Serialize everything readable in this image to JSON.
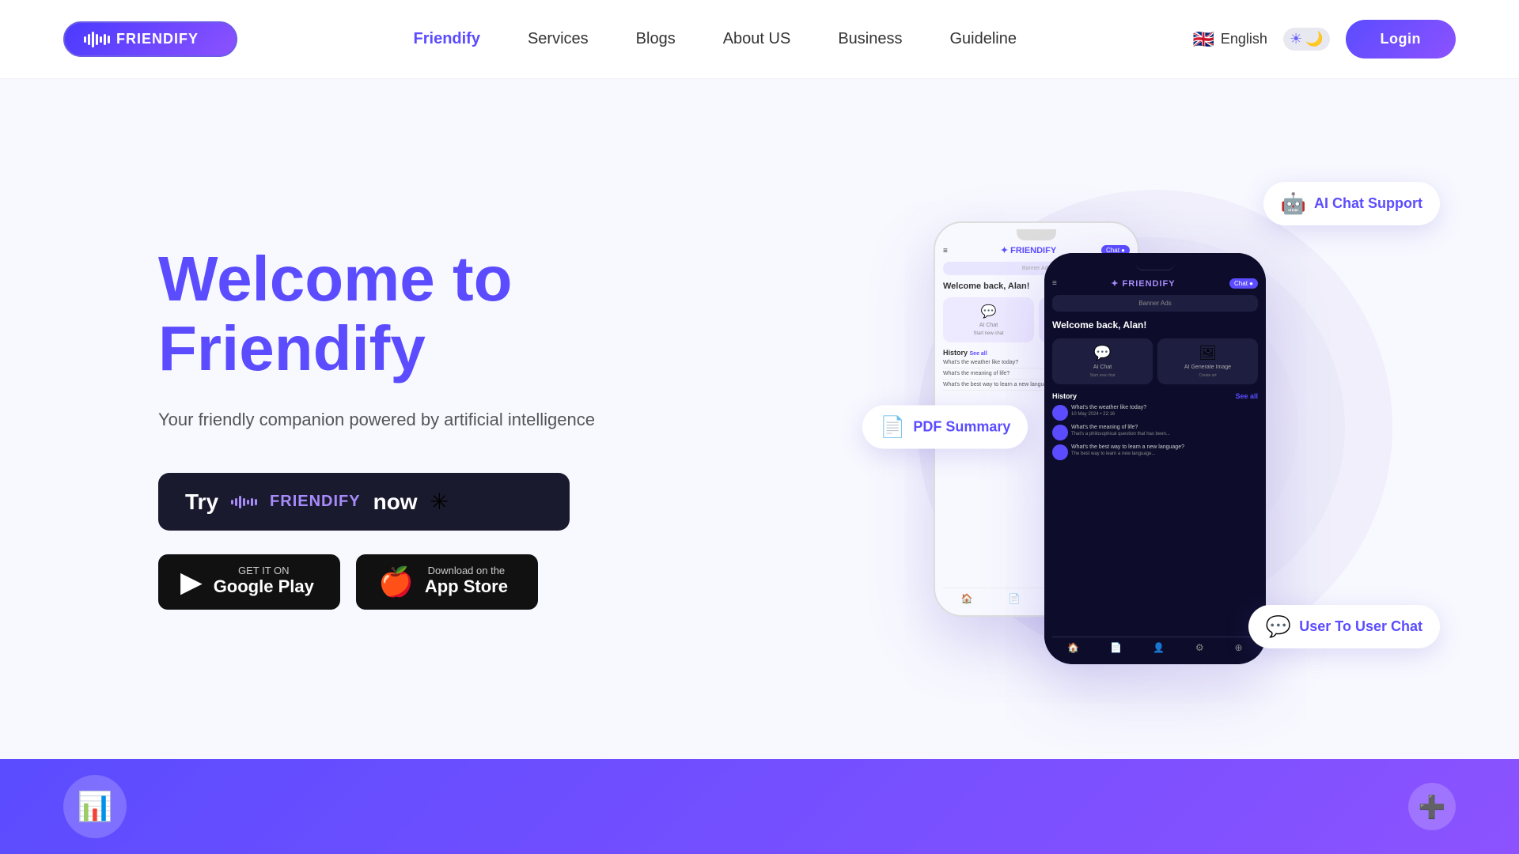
{
  "navbar": {
    "logo_text": "FRIENDIFY",
    "links": [
      {
        "label": "Friendify",
        "active": true,
        "id": "friendify"
      },
      {
        "label": "Services",
        "active": false,
        "id": "services"
      },
      {
        "label": "Blogs",
        "active": false,
        "id": "blogs"
      },
      {
        "label": "About US",
        "active": false,
        "id": "about"
      },
      {
        "label": "Business",
        "active": false,
        "id": "business"
      },
      {
        "label": "Guideline",
        "active": false,
        "id": "guideline"
      }
    ],
    "language": "English",
    "login_label": "Login"
  },
  "hero": {
    "title_line1": "Welcome to",
    "title_line2": "Friendify",
    "subtitle": "Your friendly companion powered by artificial intelligence",
    "try_text": "Try",
    "try_brand": "FRIENDIFY",
    "try_now": "now",
    "google_play_small": "GET IT ON",
    "google_play_large": "Google Play",
    "app_store_small": "Download on the",
    "app_store_large": "App Store"
  },
  "badges": {
    "ai_chat": "AI Chat Support",
    "pdf_summary": "PDF Summary",
    "user_chat": "User To User Chat"
  },
  "footer": {
    "icon_left": "📊",
    "icon_right": "➕"
  }
}
